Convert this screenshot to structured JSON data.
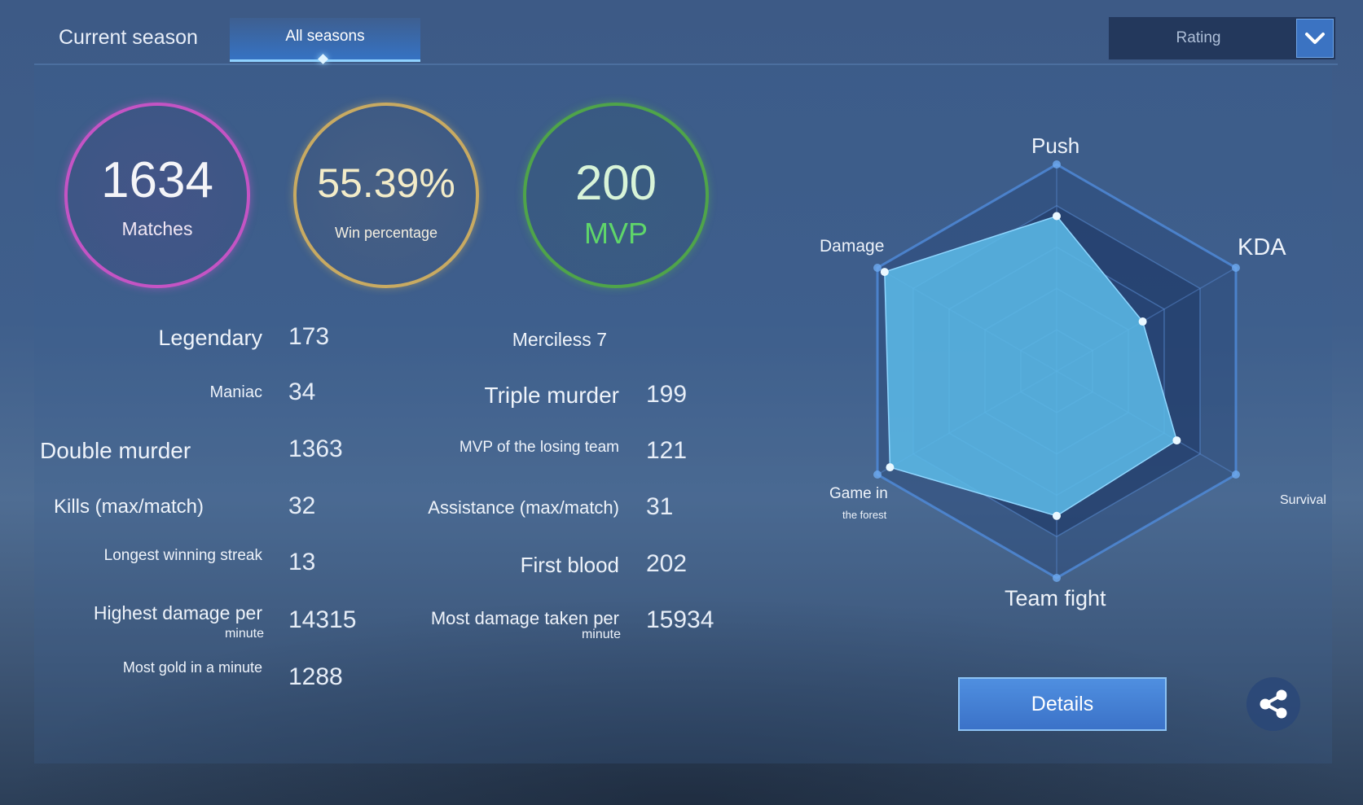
{
  "tabs": {
    "current": "Current season",
    "all": "All seasons"
  },
  "dropdown": {
    "selected": "Rating"
  },
  "summary": {
    "matches": {
      "value": "1634",
      "label": "Matches"
    },
    "win": {
      "value": "55.39%",
      "label": "Win percentage"
    },
    "mvp": {
      "value": "200",
      "label": "MVP"
    }
  },
  "stats": {
    "legendary": {
      "label": "Legendary",
      "value": "173"
    },
    "maniac": {
      "label": "Maniac",
      "value": "34"
    },
    "double_murder": {
      "label": "Double murder",
      "value": "1363"
    },
    "kills_max": {
      "label": "Kills (max/match)",
      "value": "32"
    },
    "longest_streak": {
      "label": "Longest winning streak",
      "value": "13"
    },
    "highest_damage": {
      "label": "Highest damage per",
      "sub": "minute",
      "value": "14315"
    },
    "most_gold": {
      "label": "Most gold in a minute",
      "value": "1288"
    },
    "merciless": {
      "label": "Merciless 7"
    },
    "triple_murder": {
      "label": "Triple murder",
      "value": "199"
    },
    "mvp_losing": {
      "label": "MVP of the losing team",
      "value": "121"
    },
    "assistance_max": {
      "label": "Assistance (max/match)",
      "value": "31"
    },
    "first_blood": {
      "label": "First blood",
      "value": "202"
    },
    "most_damage_taken": {
      "label": "Most damage taken per",
      "sub": "minute",
      "value": "15934"
    }
  },
  "radar": {
    "labels": {
      "push": "Push",
      "kda": "KDA",
      "survival": "Survival",
      "team_fight": "Team fight",
      "game_in": "Game in",
      "the_forest": "the forest",
      "damage": "Damage"
    },
    "fill_color": "#5bb8e6"
  },
  "chart_data": {
    "type": "radar",
    "categories": [
      "Push",
      "KDA",
      "Survival",
      "Team fight",
      "Game in the forest",
      "Damage"
    ],
    "values": [
      0.75,
      0.48,
      0.67,
      0.7,
      0.93,
      0.96
    ],
    "range": [
      0,
      1
    ],
    "series_color": "#5bb8e6"
  },
  "details_label": "Details",
  "icons": {
    "dropdown": "chevron-down-icon",
    "share": "share-icon"
  }
}
